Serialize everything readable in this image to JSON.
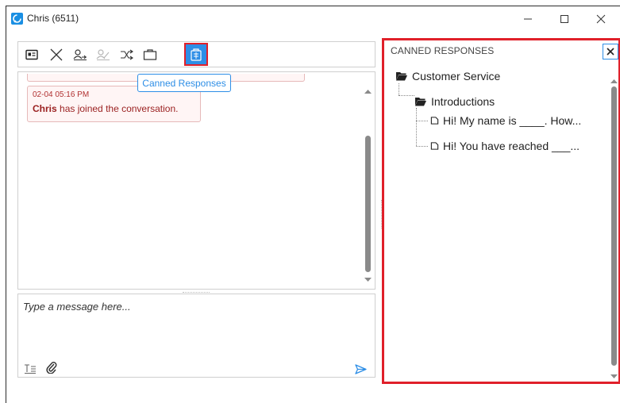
{
  "window": {
    "title": "Chris (6511)",
    "controls": {
      "minimize": "minimize",
      "maximize": "maximize",
      "close": "close"
    }
  },
  "toolbar": {
    "buttons": [
      {
        "name": "contact-card",
        "icon": "contact-card-icon"
      },
      {
        "name": "end-chat",
        "icon": "close-x-icon"
      },
      {
        "name": "transfer-user",
        "icon": "user-transfer-icon"
      },
      {
        "name": "conference-user",
        "icon": "users-disabled-icon"
      },
      {
        "name": "shuffle",
        "icon": "shuffle-icon"
      },
      {
        "name": "briefcase",
        "icon": "briefcase-icon"
      },
      {
        "name": "canned-responses",
        "icon": "canned-responses-icon",
        "active": true
      }
    ],
    "tooltip": "Canned Responses"
  },
  "conversation": {
    "messages": [
      {
        "time": "02-04 05:16 PM",
        "author": "Chris",
        "text": " has joined the conversation."
      }
    ]
  },
  "compose": {
    "placeholder": "Type a message here..."
  },
  "canned_panel": {
    "title": "CANNED RESPONSES",
    "tree": {
      "root": "Customer Service",
      "folder": "Introductions",
      "items": [
        "Hi! My name is ____. How...",
        "Hi! You have reached ___..."
      ]
    }
  },
  "colors": {
    "accent": "#2d8ee6",
    "highlight_border": "#e0202a",
    "message_text": "#9a1f1f",
    "message_bg": "#fff5f5"
  }
}
